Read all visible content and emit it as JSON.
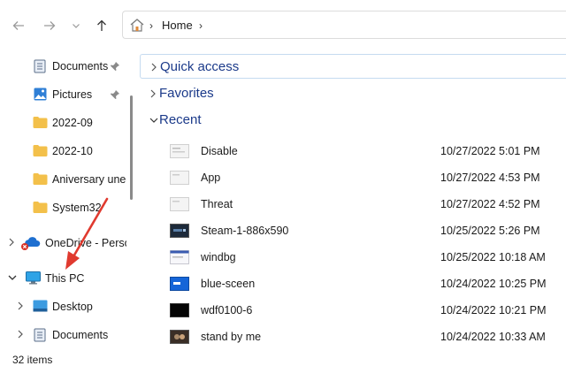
{
  "toolbar": {
    "address": {
      "home_icon": "home-icon",
      "crumbs": [
        "Home"
      ]
    }
  },
  "sidebar": {
    "items": [
      {
        "label": "Documents",
        "icon": "documents-icon",
        "pinned": true
      },
      {
        "label": "Pictures",
        "icon": "pictures-icon",
        "pinned": true
      },
      {
        "label": "2022-09",
        "icon": "folder-icon"
      },
      {
        "label": "2022-10",
        "icon": "folder-icon"
      },
      {
        "label": "Aniversary uned",
        "icon": "folder-icon"
      },
      {
        "label": "System32",
        "icon": "folder-icon"
      },
      {
        "label": "OneDrive - Perso",
        "icon": "onedrive-icon",
        "status": "error"
      },
      {
        "label": "This PC",
        "icon": "this-pc-icon",
        "expanded": true
      },
      {
        "label": "Desktop",
        "icon": "desktop-icon"
      },
      {
        "label": "Documents",
        "icon": "documents-icon"
      }
    ]
  },
  "main": {
    "groups": [
      {
        "title": "Quick access",
        "expanded": false
      },
      {
        "title": "Favorites",
        "expanded": false
      },
      {
        "title": "Recent",
        "expanded": true
      }
    ],
    "recent": [
      {
        "name": "Disable",
        "date": "10/27/2022 5:01 PM"
      },
      {
        "name": "App",
        "date": "10/27/2022 4:53 PM"
      },
      {
        "name": "Threat",
        "date": "10/27/2022 4:52 PM"
      },
      {
        "name": "Steam-1-886x590",
        "date": "10/25/2022 5:26 PM"
      },
      {
        "name": "windbg",
        "date": "10/25/2022 10:18 AM"
      },
      {
        "name": "blue-sceen",
        "date": "10/24/2022 10:25 PM"
      },
      {
        "name": "wdf0100-6",
        "date": "10/24/2022 10:21 PM"
      },
      {
        "name": "stand by me",
        "date": "10/24/2022 10:33 AM"
      }
    ]
  },
  "status": {
    "count": "32 items"
  },
  "colors": {
    "accent": "#1b3a8a",
    "folder": "#f3c04a",
    "arrow": "#e03a2f"
  }
}
